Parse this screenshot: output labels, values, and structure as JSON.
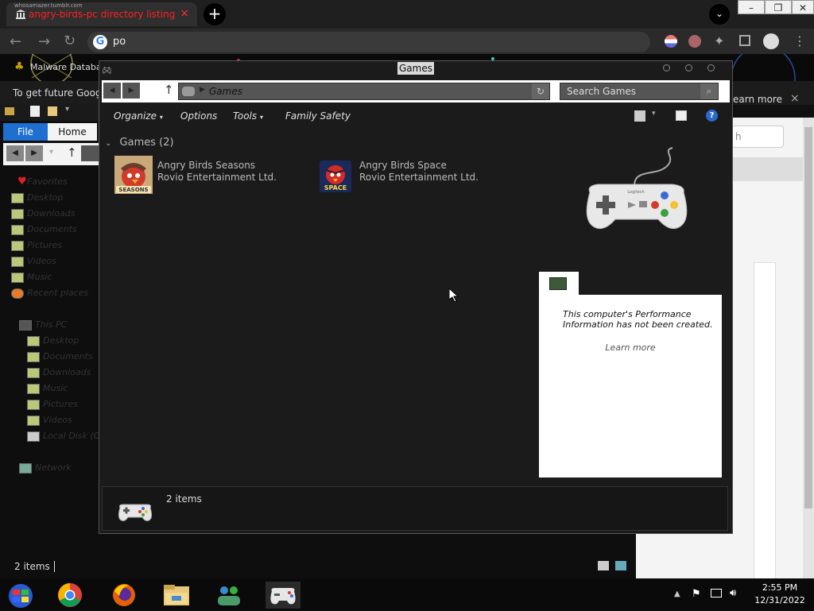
{
  "browser": {
    "tab_subtitle": "whosamazer.tumblr.com",
    "tab_title": "angry-birds-pc directory listing",
    "tab_close": "×",
    "new_tab": "+",
    "omnibox_query": "po",
    "bookmark_label": "Malware Databa",
    "infobar_text": "To get future Goog",
    "infobar_link": "earn more",
    "infobar_close": "×"
  },
  "explorer_bg": {
    "file_tab": "File",
    "home_tab": "Home",
    "favorites_label": "Favorites",
    "favorites": [
      "Desktop",
      "Downloads",
      "Documents",
      "Pictures",
      "Videos",
      "Music",
      "Recent places"
    ],
    "this_pc_label": "This PC",
    "this_pc_items": [
      "Desktop",
      "Documents",
      "Downloads",
      "Music",
      "Pictures",
      "Videos",
      "Local Disk (C:"
    ],
    "network_label": "Network",
    "status": "2 items",
    "webpage_search_hint": "h"
  },
  "games_window": {
    "title": "Games",
    "breadcrumb": "Games",
    "search_placeholder": "Search Games",
    "toolbar": {
      "organize": "Organize",
      "options": "Options",
      "tools": "Tools",
      "family_safety": "Family Safety"
    },
    "group_header": "Games (2)",
    "games": [
      {
        "name": "Angry Birds Seasons",
        "publisher": "Rovio Entertainment Ltd.",
        "icon_label": "SEASONS"
      },
      {
        "name": "Angry Birds Space",
        "publisher": "Rovio Entertainment Ltd.",
        "icon_label": "SPACE"
      }
    ],
    "controller_brand": "Logitech",
    "performance_text": "This computer's Performance Information has not been created.",
    "performance_link": "Learn more",
    "status_count": "2 items"
  },
  "taskbar": {
    "time": "2:55 PM",
    "date": "12/31/2022"
  }
}
